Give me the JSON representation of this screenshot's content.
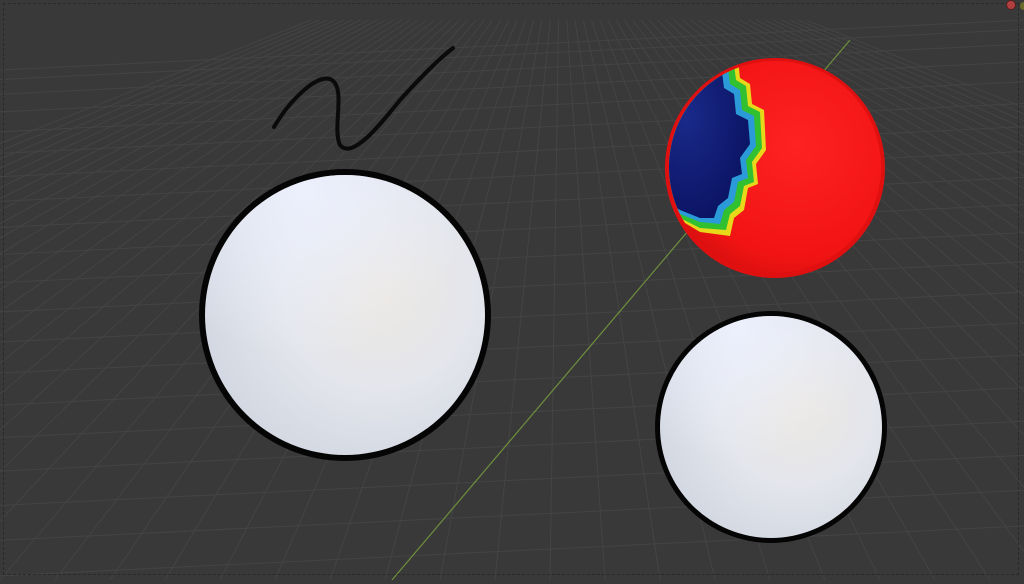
{
  "viewport": {
    "background": "#393939",
    "grid_color": "#444444",
    "axis_y_color": "#6a8a3a"
  },
  "objects": [
    {
      "id": "sphere-large",
      "material": "white",
      "outline": "black",
      "selected": false
    },
    {
      "id": "sphere-weight-paint",
      "material": "weight-paint",
      "outline": "red",
      "selected": true
    },
    {
      "id": "sphere-small",
      "material": "white",
      "outline": "black",
      "selected": false
    },
    {
      "id": "grease-pencil-stroke",
      "material": "black-stroke",
      "selected": false
    }
  ],
  "colors": {
    "white_base": "#dfe3ea",
    "outline": "#050505",
    "active_outline": "#ff2a1a",
    "weight_red": "#ee1010",
    "weight_blue": "#101a7a",
    "weight_green": "#2fbf2a",
    "weight_yellow": "#e8e020"
  }
}
